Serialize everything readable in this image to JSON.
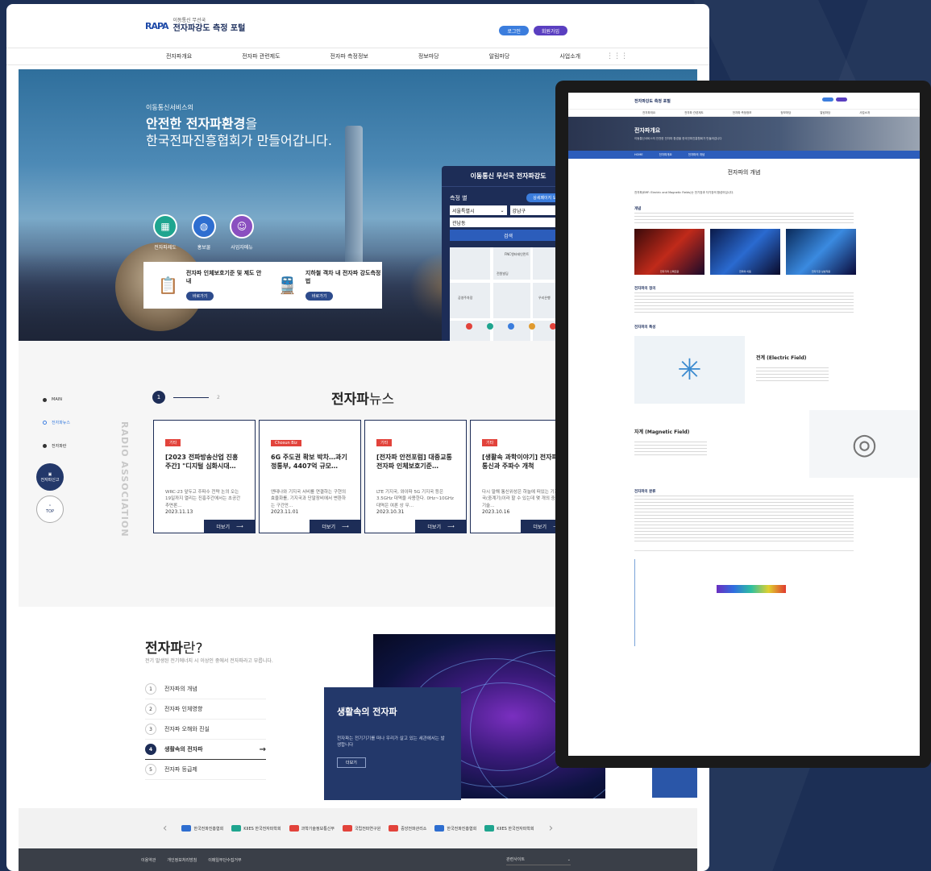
{
  "portal": {
    "logo_mark": "RAPA",
    "logo_sub": "이동통신 무선국",
    "logo_title": "전자파강도 측정 포털",
    "login_label": "로그인",
    "join_label": "회원가입",
    "nav": [
      "전자파개요",
      "전자파 관련제도",
      "전자파 측정정보",
      "정보마당",
      "알림마당",
      "사업소개"
    ],
    "hero": {
      "sub": "이동통신서비스의",
      "title_bold": "안전한 전자파환경",
      "title_rest": "을",
      "title_line2": "한국전파진흥협회가 만들어갑니다.",
      "quick": [
        "전자파제도",
        "홍보물",
        "사업자메뉴"
      ]
    },
    "info_boxes": [
      {
        "title": "전자파 인체보호기준 및 제도 안내",
        "button": "바로가기"
      },
      {
        "title": "지하철 객차 내 전자파 강도측정 법",
        "button": "바로가기"
      }
    ],
    "measure_panel": {
      "title": "이동통신 무선국 전자파강도",
      "by_station": "측정 별",
      "detail_btn": "상세페이지 보기",
      "city": "서울특별시",
      "district": "강남구",
      "dong": "관남동",
      "search_label": "검색",
      "map_labels": [
        "FNC엔터테인먼트",
        "전원빌딩",
        "공영주차장",
        "우리은행"
      ]
    },
    "side_nav": [
      "MAIN",
      "전자파뉴스",
      "전자파란"
    ],
    "float_btn": "전자파신고",
    "top_btn": "TOP",
    "vertical_text": "RADIO ASSOCIATION",
    "news": {
      "title_bold": "전자파",
      "title_rest": "뉴스",
      "page_current": "1",
      "page_next": "2",
      "more_label": "더보기",
      "cards": [
        {
          "badge": "기타",
          "title": "[2023 전파방송산업 진흥주간] \"디지털 심화시대…",
          "desc": "WRC-23 앞두고 주파수 전략 논의 오는 19일까지 열리는 진흥주간에서는 초공간 추면론…",
          "date": "2023.11.13"
        },
        {
          "badge": "Chosun Biz",
          "title": "6G 주도권 확보 박차…과기정통부, 4407억 규모…",
          "desc": "앤테나와 기지국 서비를 연결하는 구현의 효율화를, 기지국과 단말장비에서 변환하는 구간만…",
          "date": "2023.11.01"
        },
        {
          "badge": "기타",
          "title": "[전자파 안전포럼] 대중교통 전자파 인체보호기준…",
          "desc": "LTE 기지국, 와이파 5G 기지국 등은 3.5GHz 대역을 사용한다. 0Hz~10GHz 대역은 여론 상 무…",
          "date": "2023.10.31"
        },
        {
          "badge": "기타",
          "title": "[생활속 과학이야기] 전자파통신과 주파수 개척",
          "desc": "다시 말해 통신위성은 하늘에 떠있는 기지국(중계기)이라 할 수 있는데 몇 개의 중계기술…",
          "date": "2023.10.16"
        }
      ]
    },
    "what": {
      "title_bold": "전자파",
      "title_rest": "란?",
      "sub": "전기 발생된 전기에너지 시 이상인 중에서 전자파라고 부릅니다.",
      "items": [
        "전자파의 개념",
        "전자파 인체영향",
        "전자파 오해와 진실",
        "생활속의 전자파",
        "전자파 등급제"
      ],
      "active_index": 3,
      "life_title": "생활속의 전자파",
      "life_desc": "전자파는 전기기기를 떠나 우리가 살고 있는 세관에서는 발생합니다",
      "life_btn": "더보기"
    },
    "partners": [
      "한국전파진흥협회",
      "KIIES 한국전자파학회",
      "과학기술정보통신부",
      "국립전파연구원",
      "중앙전파관리소",
      "한국전파진흥협회",
      "KIIES 한국전자파학회"
    ],
    "footer": [
      "이용약관",
      "개인정보처리방침",
      "이메일무단수집거부"
    ],
    "footer_family": "관련사이트"
  },
  "tablet": {
    "logo": "전자파강도 측정 포털",
    "nav": [
      "전자파개요",
      "전자파 관련제도",
      "전자파 측정정보",
      "정보마당",
      "알림마당",
      "사업소개"
    ],
    "hero_title": "전자파개요",
    "hero_desc": "이동통신서비스의 안전한 전자파 환경을 한국전파진흥협회가 만들어갑니다",
    "bread": [
      "HOME",
      "전자파개요",
      "전자파의 개념"
    ],
    "page_title": "전자파의 개념",
    "intro": "전자파(EMF: Electric and Magnetic Fields)는 전기장과 자기장의 합성어입니다.",
    "sections": [
      "개념",
      "전자파의 정의",
      "전자파의 특성",
      "전자파의 분류"
    ],
    "image_captions": [
      "전자기파 스펙트럼",
      "전파의 이동",
      "전자기장 상호작용"
    ],
    "electric_field": "전계 (Electric Field)",
    "magnetic_field": "자계 (Magnetic Field)"
  },
  "colors": {
    "navy": "#1d2d57",
    "accent_blue": "#3b7ddd",
    "badge_red": "#e2433b",
    "background": "#1c2f55"
  }
}
